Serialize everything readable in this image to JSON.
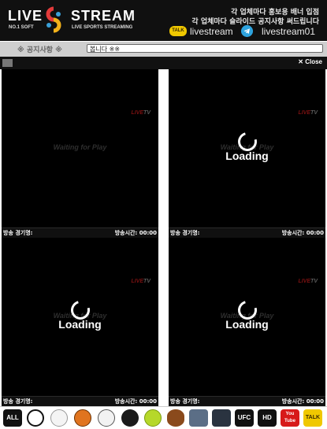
{
  "header": {
    "logo_live": "LIVE",
    "logo_stream": "STREAM",
    "logo_sub_left": "NO.1 SOFT",
    "logo_sub_right": "LIVE SPORTS STREAMING",
    "banner_line1": "각 업체마다 홍보용 배너 입점",
    "banner_line2": "각 업체마다 슬라이드 공지사항 써드립니다",
    "talk_badge": "TALK",
    "talk_id": "livestream",
    "telegram_id": "livestream01"
  },
  "notice": {
    "label": "※ 공지사항 ※",
    "text": "봅니다 ※※"
  },
  "toolbar": {
    "close_label": "✕ Close"
  },
  "panels": [
    {
      "state": "waiting",
      "watermark_text": "Waiting for Play",
      "brand": "LIVE",
      "brand_tv": "TV",
      "loading_text": "",
      "game_label": "방송 경기명:",
      "time_label": "방송시간: 00:00"
    },
    {
      "state": "loading",
      "watermark_text": "Waiting for Play",
      "brand": "LIVE",
      "brand_tv": "TV",
      "loading_text": "Loading",
      "game_label": "방송 경기명:",
      "time_label": "방송시간: 00:00"
    },
    {
      "state": "loading",
      "watermark_text": "Waiting for Play",
      "brand": "LIVE",
      "brand_tv": "TV",
      "loading_text": "Loading",
      "game_label": "방송 경기명:",
      "time_label": "방송시간: 00:00"
    },
    {
      "state": "loading",
      "watermark_text": "Waiting for Play",
      "brand": "LIVE",
      "brand_tv": "TV",
      "loading_text": "Loading",
      "game_label": "방송 경기명:",
      "time_label": "방송시간: 00:00"
    }
  ],
  "sports_bar": {
    "items": [
      {
        "icon": "all-icon",
        "label": "ALL",
        "color": "#111111"
      },
      {
        "icon": "soccer-icon",
        "label": "",
        "color": "#ffffff"
      },
      {
        "icon": "baseball-icon",
        "label": "",
        "color": "#f4f4f4"
      },
      {
        "icon": "basketball-icon",
        "label": "",
        "color": "#e0741f"
      },
      {
        "icon": "volleyball-icon",
        "label": "",
        "color": "#f2f2f2"
      },
      {
        "icon": "hockey-icon",
        "label": "",
        "color": "#1a1a1a"
      },
      {
        "icon": "tennis-icon",
        "label": "",
        "color": "#b6d82a"
      },
      {
        "icon": "football-icon",
        "label": "",
        "color": "#8a4a1c"
      },
      {
        "icon": "starcraft-icon",
        "label": "",
        "color": "#5b6e86"
      },
      {
        "icon": "overwatch-icon",
        "label": "",
        "color": "#2a3340"
      },
      {
        "icon": "ufc-icon",
        "label": "UFC",
        "color": "#111111"
      },
      {
        "icon": "hd-icon",
        "label": "HD",
        "color": "#111111"
      },
      {
        "icon": "youtube-icon",
        "label": "You Tube",
        "color": "#d71a1a"
      },
      {
        "icon": "kakaotalk-icon",
        "label": "TALK",
        "color": "#f0c800"
      }
    ]
  }
}
